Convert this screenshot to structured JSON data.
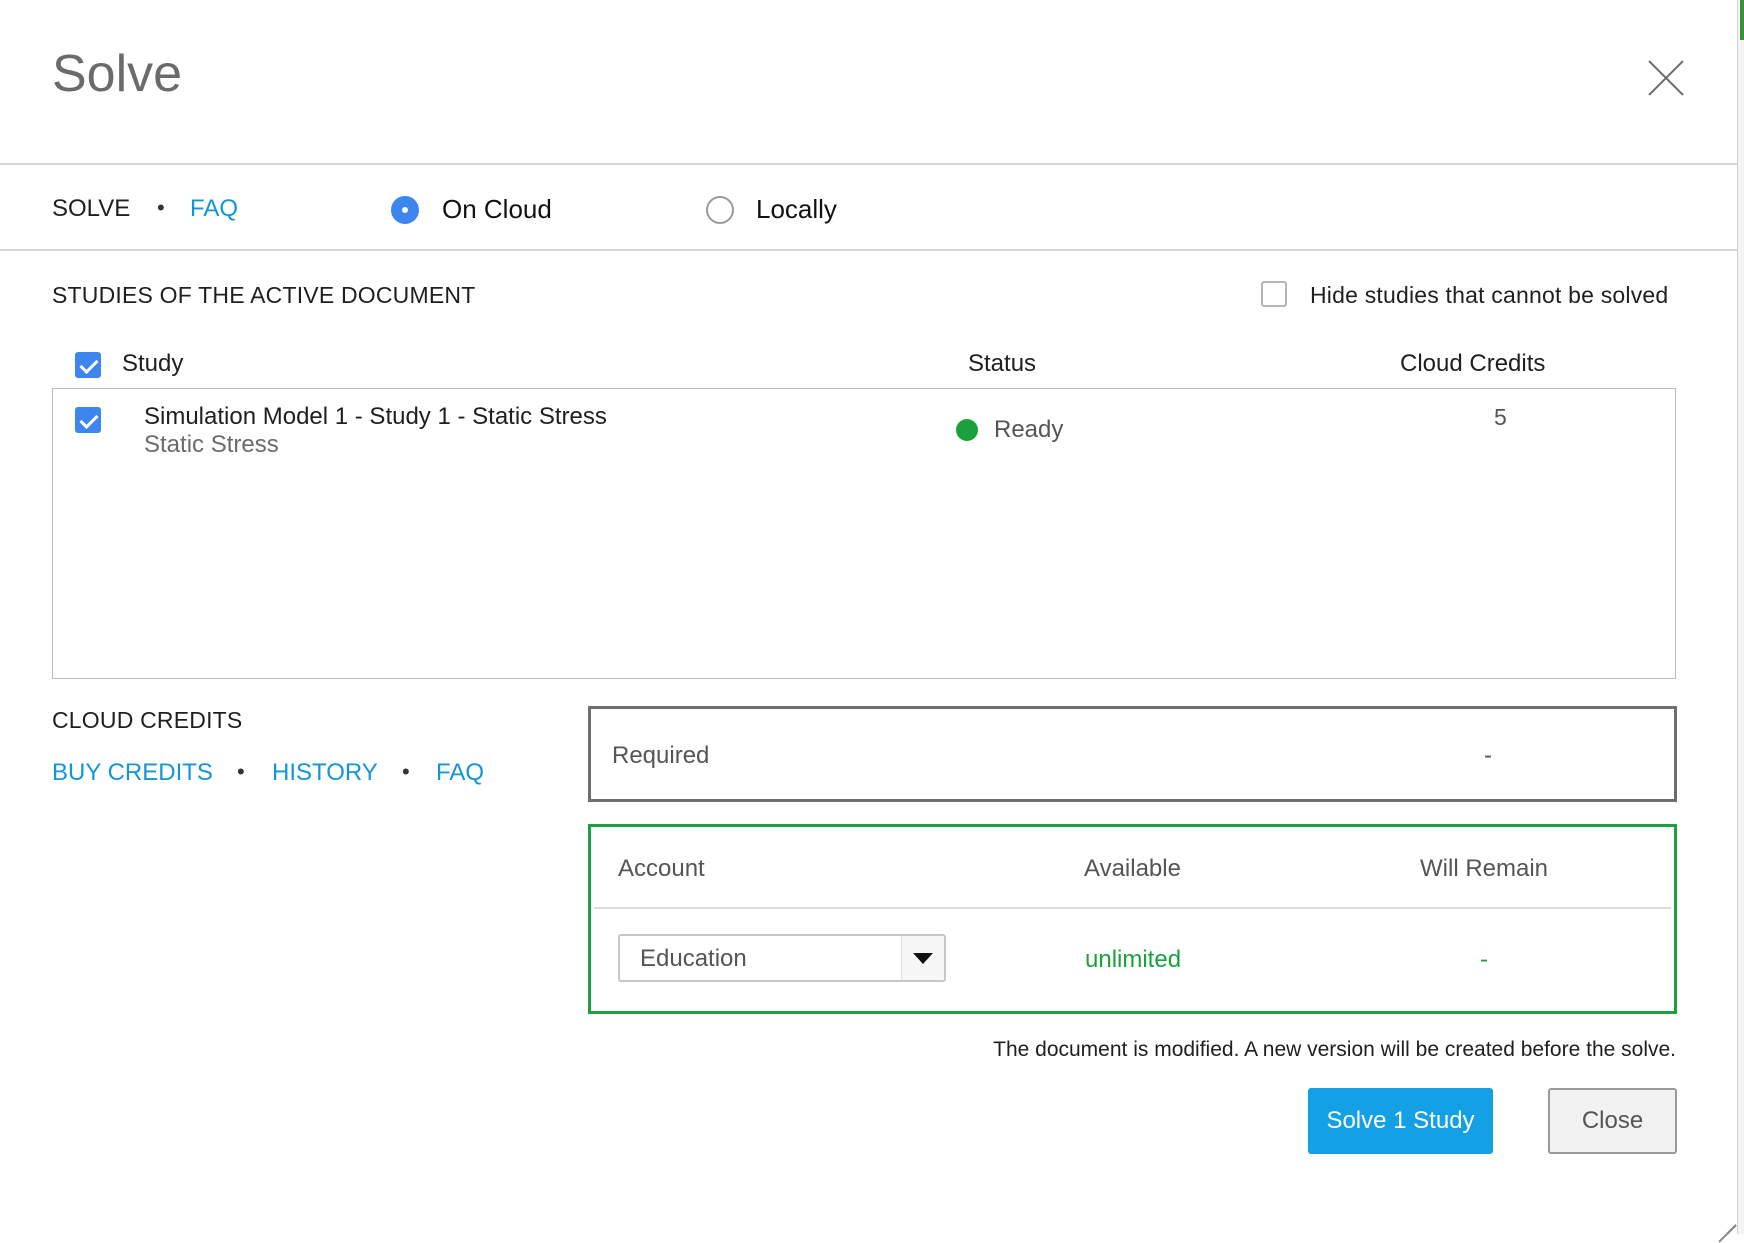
{
  "dialog": {
    "title": "Solve"
  },
  "solve_bar": {
    "solve_label": "SOLVE",
    "separator": "•",
    "faq_link": "FAQ",
    "options": [
      {
        "label": "On Cloud",
        "selected": true
      },
      {
        "label": "Locally",
        "selected": false
      }
    ]
  },
  "studies": {
    "section_title": "STUDIES OF THE ACTIVE DOCUMENT",
    "hide_unsolvable_label": "Hide studies that cannot be solved",
    "hide_unsolvable_checked": false,
    "select_all_checked": true,
    "columns": {
      "study": "Study",
      "status": "Status",
      "cloud_credits": "Cloud Credits"
    },
    "rows": [
      {
        "checked": true,
        "title": "Simulation Model 1 - Study 1 - Static Stress",
        "subtitle": "Static Stress",
        "status": "Ready",
        "status_color": "#1aa13d",
        "cloud_credits": "5"
      }
    ]
  },
  "cloud_credits": {
    "section_title": "CLOUD CREDITS",
    "links": {
      "buy_credits": "BUY CREDITS",
      "history": "HISTORY",
      "faq": "FAQ"
    },
    "separator": "•",
    "required_label": "Required",
    "required_value": "-",
    "account_table": {
      "columns": {
        "account": "Account",
        "available": "Available",
        "will_remain": "Will Remain"
      },
      "selected_account": "Education",
      "available": "unlimited",
      "will_remain": "-",
      "highlight_color": "#1aa13d"
    }
  },
  "footer": {
    "notice": "The document is modified. A new version will be created before the solve.",
    "solve_button": "Solve 1 Study",
    "close_button": "Close"
  },
  "colors": {
    "accent_blue": "#13a0e4",
    "link_blue": "#1396d8",
    "checkbox_blue": "#3d86f0",
    "ready_green": "#1aa13d"
  }
}
